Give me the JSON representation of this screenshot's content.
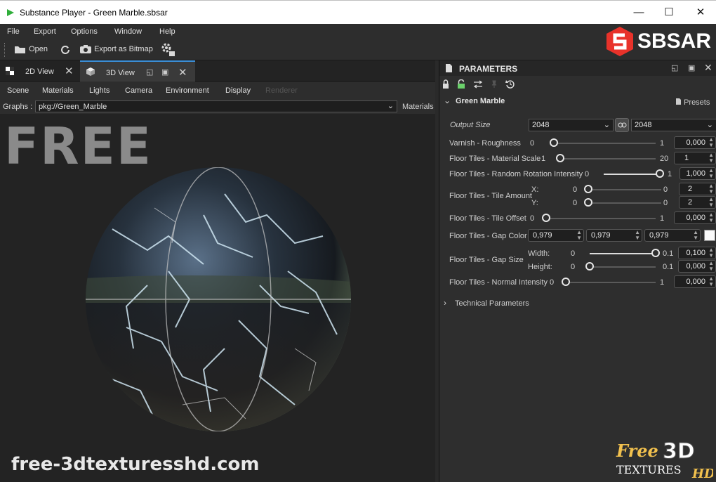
{
  "window": {
    "title": "Substance Player - Green Marble.sbsar",
    "minimize": "—",
    "maximize": "☐",
    "close": "✕"
  },
  "menu": [
    "File",
    "Export",
    "Options",
    "Window",
    "Help"
  ],
  "toolbar": {
    "open_label": "Open",
    "export_label": "Export as Bitmap"
  },
  "brand_logo": {
    "text": "SBSAR",
    "color": "#e8322a"
  },
  "tabs": [
    {
      "label": "2D View",
      "active": false
    },
    {
      "label": "3D View",
      "active": true
    }
  ],
  "view_menu": [
    "Scene",
    "Materials",
    "Lights",
    "Camera",
    "Environment",
    "Display",
    "Renderer"
  ],
  "graphs": {
    "label": "Graphs :",
    "value": "pkg://Green_Marble",
    "materials_label": "Materials"
  },
  "viewport": {
    "overlay_text": "FREE",
    "watermark": "free-3dtexturesshd.com"
  },
  "panel": {
    "title": "PARAMETERS",
    "group_name": "Green Marble",
    "presets_label": "Presets",
    "output_size": {
      "label": "Output Size",
      "width": "2048",
      "height": "2048"
    },
    "params": {
      "varnish": {
        "label": "Varnish - Roughness",
        "min": "0",
        "max": "1",
        "value": "0,000",
        "fraction": 0.0
      },
      "material_scale": {
        "label": "Floor Tiles - Material Scale",
        "min": "1",
        "max": "20",
        "value": "1",
        "fraction": 0.0
      },
      "random_rotation": {
        "label": "Floor Tiles - Random Rotation Intensity",
        "min": "0",
        "max": "1",
        "value": "1,000",
        "fraction": 1.0
      },
      "tile_amount": {
        "label": "Floor Tiles - Tile Amount",
        "x_label": "X:",
        "y_label": "Y:",
        "x_min": "0",
        "x_max": "0",
        "x_value": "2",
        "x_fraction": 0.0,
        "y_min": "0",
        "y_max": "0",
        "y_value": "2",
        "y_fraction": 0.0
      },
      "tile_offset": {
        "label": "Floor Tiles - Tile Offset",
        "min": "0",
        "max": "1",
        "value": "0,000",
        "fraction": 0.0
      },
      "gap_color": {
        "label": "Floor Tiles - Gap Color",
        "r": "0,979",
        "g": "0,979",
        "b": "0,979",
        "swatch": "#fafafa"
      },
      "gap_size": {
        "label": "Floor Tiles - Gap Size",
        "width_label": "Width:",
        "height_label": "Height:",
        "w_min": "0",
        "w_max": "0.1",
        "w_value": "0,100",
        "w_fraction": 1.0,
        "h_min": "0",
        "h_max": "0.1",
        "h_value": "0,000",
        "h_fraction": 0.0
      },
      "normal_intensity": {
        "label": "Floor Tiles - Normal Intensity",
        "min": "0",
        "max": "1",
        "value": "0,000",
        "fraction": 0.0
      }
    },
    "technical_label": "Technical Parameters"
  },
  "corner_logo": {
    "line1": "Free",
    "line2": "3D",
    "line3": "TEXTURES",
    "line4": "HD"
  }
}
